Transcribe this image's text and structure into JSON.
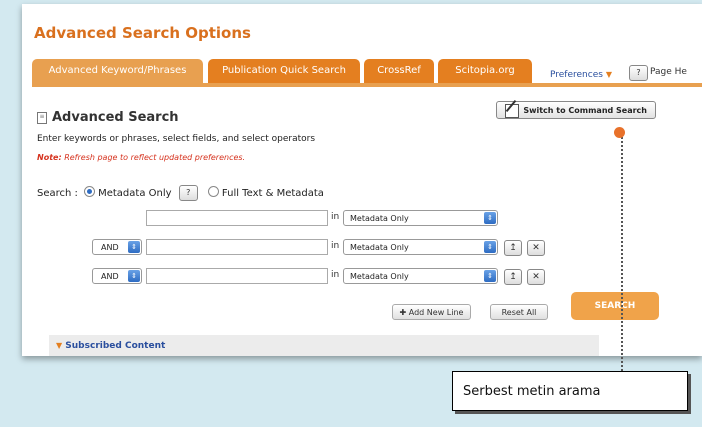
{
  "page_title": "Advanced Search Options",
  "tabs": [
    {
      "label": "Advanced Keyword/Phrases",
      "active": true
    },
    {
      "label": "Publication Quick Search",
      "active": false
    },
    {
      "label": "CrossRef",
      "active": false
    },
    {
      "label": "Scitopia.org",
      "active": false
    }
  ],
  "preferences": "Preferences",
  "help_button": "?",
  "page_help": "Page He",
  "section": {
    "title": "Advanced Search",
    "switch_button": "Switch to Command Search",
    "instructions": "Enter keywords or phrases, select fields, and select operators",
    "note_label": "Note:",
    "note_text": "Refresh page to reflect updated preferences."
  },
  "search_scope": {
    "label": "Search :",
    "option_metadata": "Metadata Only",
    "help": "?",
    "option_fulltext": "Full Text & Metadata",
    "selected": "Metadata Only"
  },
  "rows": [
    {
      "operator": "",
      "value": "",
      "in_label": "in",
      "field": "Metadata Only"
    },
    {
      "operator": "AND",
      "value": "",
      "in_label": "in",
      "field": "Metadata Only"
    },
    {
      "operator": "AND",
      "value": "",
      "in_label": "in",
      "field": "Metadata Only"
    }
  ],
  "row_icons": {
    "move_up": "up-arrow-icon",
    "remove": "close-icon"
  },
  "add_new_line": "Add New Line",
  "reset_all": "Reset All",
  "search_button": "SEARCH",
  "subscribed_content": "Subscribed Content",
  "callout": "Serbest metin arama",
  "colors": {
    "accent": "#e47f20",
    "background": "#d3e9f0",
    "link": "#2a4f9e",
    "note": "#d6331f"
  }
}
